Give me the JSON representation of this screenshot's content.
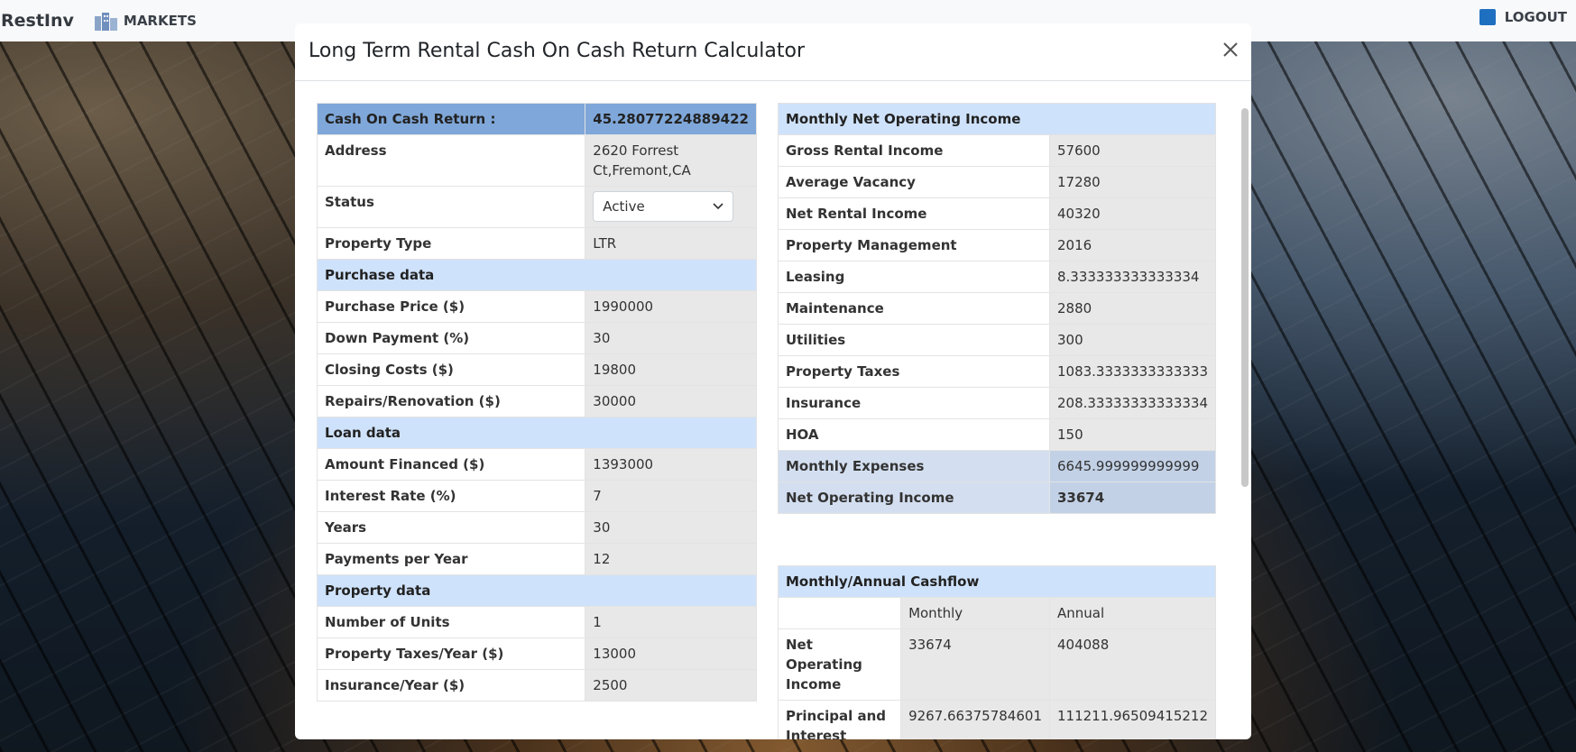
{
  "nav": {
    "brand": "RestInv",
    "markets": "MARKETS",
    "logout": "LOGOUT"
  },
  "modal": {
    "title": "Long Term Rental Cash On Cash Return Calculator"
  },
  "left_rows": [
    {
      "label": "Cash On Cash Return :",
      "value": "45.28077224889422",
      "kind": "highlight"
    },
    {
      "label": "Address",
      "value": "2620 Forrest Ct,Fremont,CA",
      "kind": "row"
    },
    {
      "label": "Status",
      "value": "Active",
      "kind": "select"
    },
    {
      "label": "Property Type",
      "value": "LTR",
      "kind": "row"
    },
    {
      "label": "Purchase data",
      "kind": "section"
    },
    {
      "label": "Purchase Price ($)",
      "value": "1990000",
      "kind": "row"
    },
    {
      "label": "Down Payment (%)",
      "value": "30",
      "kind": "row"
    },
    {
      "label": "Closing Costs ($)",
      "value": "19800",
      "kind": "row"
    },
    {
      "label": "Repairs/Renovation ($)",
      "value": "30000",
      "kind": "row"
    },
    {
      "label": "Loan data",
      "kind": "section"
    },
    {
      "label": "Amount Financed ($)",
      "value": "1393000",
      "kind": "row"
    },
    {
      "label": "Interest Rate (%)",
      "value": "7",
      "kind": "row"
    },
    {
      "label": "Years",
      "value": "30",
      "kind": "row"
    },
    {
      "label": "Payments per Year",
      "value": "12",
      "kind": "row"
    },
    {
      "label": "Property data",
      "kind": "section"
    },
    {
      "label": "Number of Units",
      "value": "1",
      "kind": "row"
    },
    {
      "label": "Property Taxes/Year ($)",
      "value": "13000",
      "kind": "row"
    },
    {
      "label": "Insurance/Year ($)",
      "value": "2500",
      "kind": "row"
    }
  ],
  "noi": {
    "title": "Monthly Net Operating Income",
    "rows": [
      {
        "label": "Gross Rental Income",
        "value": "57600"
      },
      {
        "label": "Average Vacancy",
        "value": "17280"
      },
      {
        "label": "Net Rental Income",
        "value": "40320"
      },
      {
        "label": "Property Management",
        "value": "2016"
      },
      {
        "label": "Leasing",
        "value": "8.333333333333334"
      },
      {
        "label": "Maintenance",
        "value": "2880"
      },
      {
        "label": "Utilities",
        "value": "300"
      },
      {
        "label": "Property Taxes",
        "value": "1083.3333333333333"
      },
      {
        "label": "Insurance",
        "value": "208.33333333333334"
      },
      {
        "label": "HOA",
        "value": "150"
      }
    ],
    "monthly_expenses_label": "Monthly Expenses",
    "monthly_expenses_value": "6645.999999999999",
    "net_operating_income_label": "Net Operating Income",
    "net_operating_income_value": "33674"
  },
  "cashflow": {
    "title": "Monthly/Annual Cashflow",
    "col_monthly": "Monthly",
    "col_annual": "Annual",
    "rows": [
      {
        "label": "Net Operating Income",
        "monthly": "33674",
        "annual": "404088"
      },
      {
        "label": "Principal and Interest",
        "monthly": "9267.66375784601",
        "annual": "111211.96509415212"
      }
    ]
  }
}
